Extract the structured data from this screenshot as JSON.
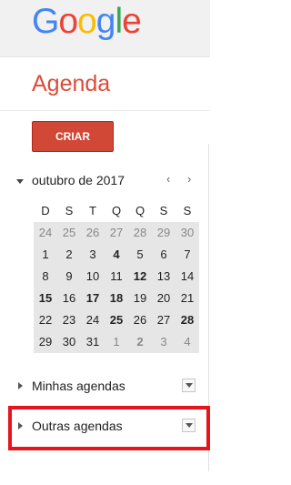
{
  "header": {
    "logo_letters": [
      {
        "ch": "G",
        "color": "#4285f4"
      },
      {
        "ch": "o",
        "color": "#ea4335"
      },
      {
        "ch": "o",
        "color": "#fbbc05"
      },
      {
        "ch": "g",
        "color": "#4285f4"
      },
      {
        "ch": "l",
        "color": "#34a853"
      },
      {
        "ch": "e",
        "color": "#ea4335"
      }
    ],
    "app_name": "Agenda"
  },
  "create_button": "CRIAR",
  "mini_calendar": {
    "month_label": "outubro de 2017",
    "prev_icon": "‹",
    "next_icon": "›",
    "weekdays": [
      "D",
      "S",
      "T",
      "Q",
      "Q",
      "S",
      "S"
    ],
    "weeks": [
      [
        {
          "d": "24",
          "other": true
        },
        {
          "d": "25",
          "other": true
        },
        {
          "d": "26",
          "other": true
        },
        {
          "d": "27",
          "other": true
        },
        {
          "d": "28",
          "other": true
        },
        {
          "d": "29",
          "other": true
        },
        {
          "d": "30",
          "other": true
        }
      ],
      [
        {
          "d": "1"
        },
        {
          "d": "2"
        },
        {
          "d": "3"
        },
        {
          "d": "4",
          "bold": true
        },
        {
          "d": "5"
        },
        {
          "d": "6"
        },
        {
          "d": "7"
        }
      ],
      [
        {
          "d": "8"
        },
        {
          "d": "9"
        },
        {
          "d": "10"
        },
        {
          "d": "11"
        },
        {
          "d": "12",
          "bold": true
        },
        {
          "d": "13"
        },
        {
          "d": "14"
        }
      ],
      [
        {
          "d": "15",
          "bold": true
        },
        {
          "d": "16"
        },
        {
          "d": "17",
          "bold": true
        },
        {
          "d": "18",
          "bold": true
        },
        {
          "d": "19"
        },
        {
          "d": "20"
        },
        {
          "d": "21"
        }
      ],
      [
        {
          "d": "22"
        },
        {
          "d": "23"
        },
        {
          "d": "24"
        },
        {
          "d": "25",
          "bold": true
        },
        {
          "d": "26"
        },
        {
          "d": "27"
        },
        {
          "d": "28",
          "bold": true
        }
      ],
      [
        {
          "d": "29"
        },
        {
          "d": "30"
        },
        {
          "d": "31"
        },
        {
          "d": "1",
          "other": true
        },
        {
          "d": "2",
          "other": true,
          "bold": true
        },
        {
          "d": "3",
          "other": true
        },
        {
          "d": "4",
          "other": true
        }
      ]
    ]
  },
  "sections": {
    "my_calendars": "Minhas agendas",
    "other_calendars": "Outras agendas"
  },
  "colors": {
    "accent_red": "#dd4b39",
    "button_red": "#d14836",
    "highlight_box": "#e8141c"
  }
}
